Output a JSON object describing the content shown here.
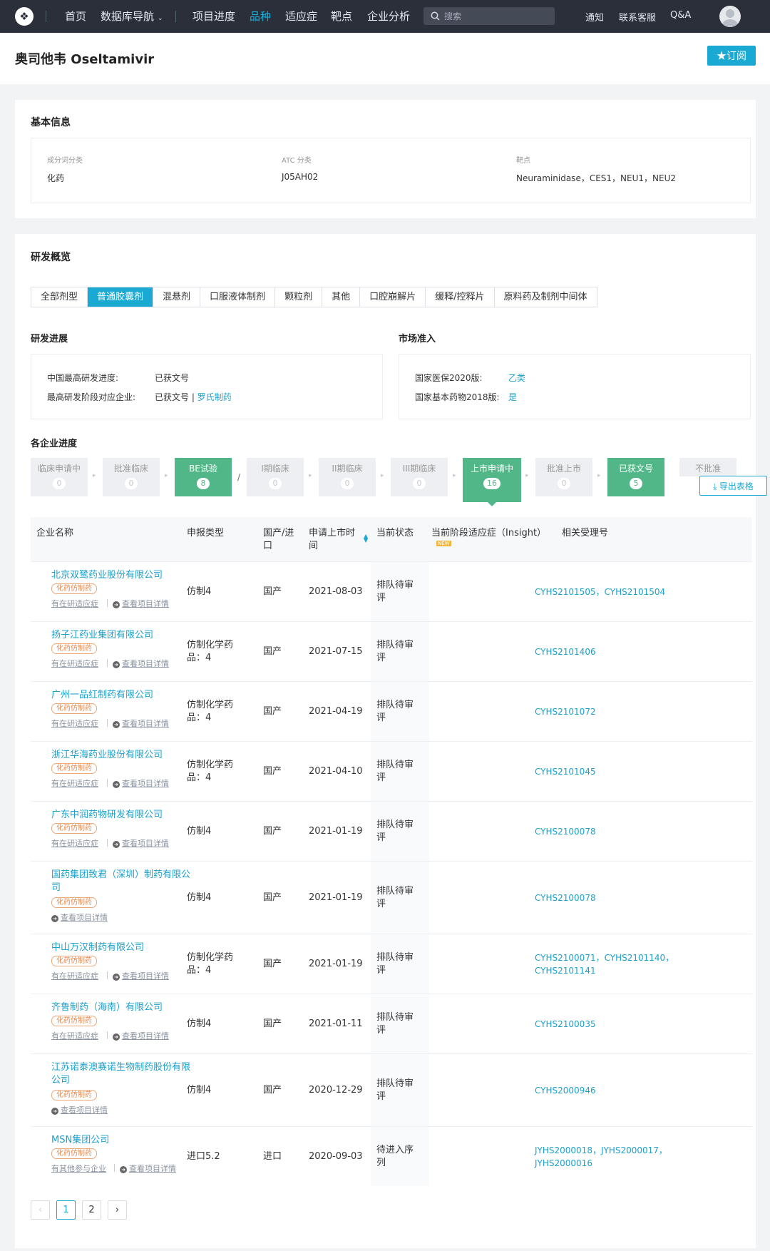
{
  "nav": {
    "items": [
      "首页",
      "数据库导航",
      "项目进度",
      "品种",
      "适应症",
      "靶点",
      "企业分析"
    ],
    "dropdown_icon": "chevron-down-icon",
    "search_placeholder": "搜索",
    "right": [
      "通知",
      "联系客服",
      "Q&A"
    ],
    "active": "品种"
  },
  "header": {
    "title": "奥司他韦 Oseltamivir",
    "subscribe": "★订阅"
  },
  "basic": {
    "title": "基本信息",
    "fields": [
      {
        "label": "成分词分类",
        "value": "化药"
      },
      {
        "label": "ATC 分类",
        "value": "J05AH02"
      },
      {
        "label": "靶点",
        "value": "Neuraminidase，CES1，NEU1，NEU2"
      }
    ]
  },
  "overview": {
    "title": "研发概览",
    "tabs": [
      "全部剂型",
      "普通胶囊剂",
      "混悬剂",
      "口服液体制剂",
      "颗粒剂",
      "其他",
      "口腔崩解片",
      "缓释/控释片",
      "原料药及制剂中间体"
    ],
    "active_tab": "普通胶囊剂"
  },
  "progress": {
    "title": "研发进展",
    "rows": [
      {
        "k": "中国最高研发进度:",
        "v": "已获文号"
      },
      {
        "k": "最高研发阶段对应企业:",
        "v": "已获文号 |",
        "link": "罗氏制药"
      }
    ]
  },
  "market": {
    "title": "市场准入",
    "rows": [
      {
        "k": "国家医保2020版:",
        "v": "乙类"
      },
      {
        "k": "国家基本药物2018版:",
        "v": "是"
      }
    ]
  },
  "stages": {
    "title": "各企业进度",
    "items": [
      {
        "name": "临床申请中",
        "count": "0"
      },
      {
        "name": "批准临床",
        "count": "0"
      },
      {
        "name": "BE试验",
        "count": "8"
      },
      {
        "name": "I期临床",
        "count": "0"
      },
      {
        "name": "II期临床",
        "count": "0"
      },
      {
        "name": "III期临床",
        "count": "0"
      },
      {
        "name": "上市申请中",
        "count": "16"
      },
      {
        "name": "批准上市",
        "count": "0"
      },
      {
        "name": "已获文号",
        "count": "5"
      },
      {
        "name": "不批准",
        "count": ""
      }
    ],
    "export": "导出表格"
  },
  "table": {
    "headers": [
      "企业名称",
      "申报类型",
      "国产/进口",
      "申请上市时间",
      "当前状态",
      "当前阶段适应症（Insight）",
      "相关受理号"
    ],
    "new_tag": "NEW",
    "badge": "化药仿制药",
    "link_research": "有在研适应症",
    "link_other": "有其他参与企业",
    "link_detail": "查看项目详情",
    "rows": [
      {
        "company": "北京双鹭药业股份有限公司",
        "type": "仿制4",
        "origin": "国产",
        "date": "2021-08-03",
        "status": "排队待审评",
        "acc": "CYHS2101505，CYHS2101504"
      },
      {
        "company": "扬子江药业集团有限公司",
        "type": "仿制化学药品：4",
        "origin": "国产",
        "date": "2021-07-15",
        "status": "排队待审评",
        "acc": "CYHS2101406"
      },
      {
        "company": "广州一品红制药有限公司",
        "type": "仿制化学药品：4",
        "origin": "国产",
        "date": "2021-04-19",
        "status": "排队待审评",
        "acc": "CYHS2101072"
      },
      {
        "company": "浙江华海药业股份有限公司",
        "type": "仿制化学药品：4",
        "origin": "国产",
        "date": "2021-04-10",
        "status": "排队待审评",
        "acc": "CYHS2101045"
      },
      {
        "company": "广东中润药物研发有限公司",
        "type": "仿制4",
        "origin": "国产",
        "date": "2021-01-19",
        "status": "排队待审评",
        "acc": "CYHS2100078"
      },
      {
        "company": "国药集团致君（深圳）制药有限公司",
        "type": "仿制4",
        "origin": "国产",
        "date": "2021-01-19",
        "status": "排队待审评",
        "acc": "CYHS2100078"
      },
      {
        "company": "中山万汉制药有限公司",
        "type": "仿制化学药品：4",
        "origin": "国产",
        "date": "2021-01-19",
        "status": "排队待审评",
        "acc": "CYHS2100071，CYHS2101140，CYHS2101141"
      },
      {
        "company": "齐鲁制药（海南）有限公司",
        "type": "仿制4",
        "origin": "国产",
        "date": "2021-01-11",
        "status": "排队待审评",
        "acc": "CYHS2100035"
      },
      {
        "company": "江苏诺泰澳赛诺生物制药股份有限公司",
        "type": "仿制4",
        "origin": "国产",
        "date": "2020-12-29",
        "status": "排队待审评",
        "acc": "CYHS2000946"
      },
      {
        "company": "MSN集团公司",
        "type": "进口5.2",
        "origin": "进口",
        "date": "2020-09-03",
        "status": "待进入序列",
        "acc": "JYHS2000018，JYHS2000017，JYHS2000016"
      }
    ]
  },
  "pagination": {
    "pages": [
      "1",
      "2"
    ],
    "current": "1",
    "prev": "‹",
    "next": "›"
  }
}
